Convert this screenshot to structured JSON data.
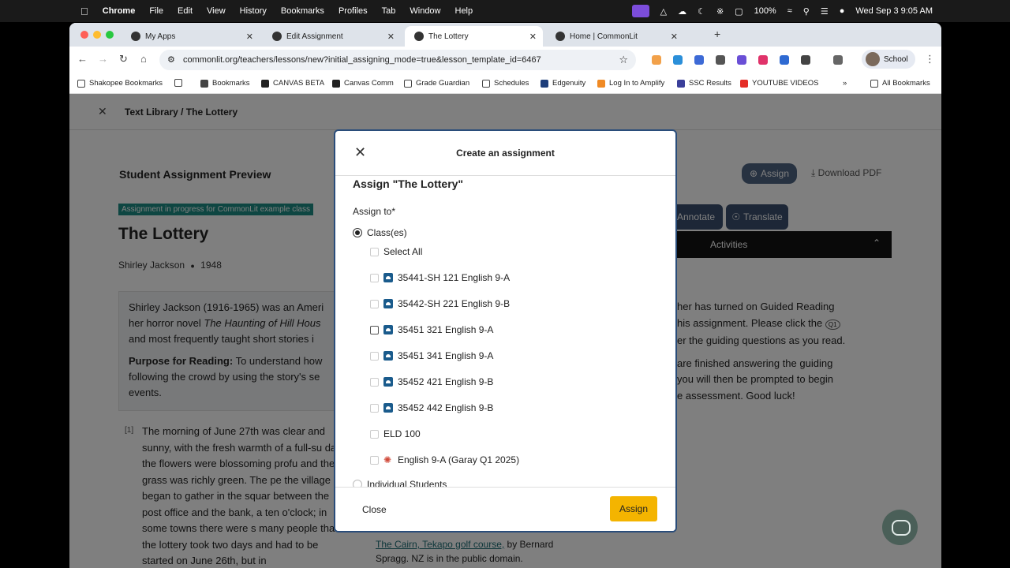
{
  "menubar": {
    "app": "Chrome",
    "items": [
      "File",
      "Edit",
      "View",
      "History",
      "Bookmarks",
      "Profiles",
      "Tab",
      "Window",
      "Help"
    ],
    "battery": "100%",
    "datetime": "Wed Sep 3  9:05 AM"
  },
  "tabs": [
    {
      "label": "My Apps"
    },
    {
      "label": "Edit Assignment"
    },
    {
      "label": "The Lottery"
    },
    {
      "label": "Home | CommonLit"
    }
  ],
  "toolbar": {
    "url": "commonlit.org/teachers/lessons/new?initial_assigning_mode=true&lesson_template_id=6467",
    "profile": "School"
  },
  "bookmarks": [
    "Shakopee Bookmarks",
    "Bookmarks",
    "CANVAS BETA",
    "Canvas Comm",
    "Grade Guardian",
    "Schedules",
    "Edgenuity",
    "Log In to Amplify",
    "SSC Results",
    "YOUTUBE VIDEOS",
    "All Bookmarks"
  ],
  "page": {
    "breadcrumb": "Text Library / The Lottery",
    "preview_title": "Student Assignment Preview",
    "badge": "Assignment in progress for CommonLit example class",
    "book_title": "The Lottery",
    "author": "Shirley Jackson",
    "year": "1948",
    "intro_line1": "Shirley Jackson (1916-1965) was an Ameri",
    "intro_line2a": "her horror novel ",
    "intro_line2b": "The Haunting of Hill Hous",
    "intro_line3": "and most frequently taught short stories i",
    "purpose_label": "Purpose for Reading:",
    "purpose_text": " To understand how",
    "purpose_line2": "following the crowd by using the story's se",
    "purpose_line3": "events.",
    "para_num": "[1]",
    "para_text": "The morning of June 27th was clear and sunny, with the fresh warmth of a full-su day; the flowers were blossoming profu and the grass was richly green. The pe the village began to gather in the squar between the post office and the bank, a ten o'clock; in some towns there were s many people that the lottery took two days and had to be started on June 26th, but in",
    "caption_link": "The Cairn, Tekapo golf course,",
    "caption_text": " by Bernard Spragg. NZ is in the public domain.",
    "assign_btn": "Assign",
    "download": "Download PDF",
    "annotate": "Annotate",
    "translate": "Translate",
    "activities": "Activities",
    "guided_p1a": "her has turned on Guided Reading",
    "guided_p1b": "his assignment. Please click the",
    "guided_p1c": "er the guiding questions as you read.",
    "guided_p2a": "are finished answering the guiding",
    "guided_p2b": "you will then be prompted to begin",
    "guided_p2c": "e assessment. Good luck!"
  },
  "modal": {
    "title": "Create an assignment",
    "assign_heading": "Assign \"The Lottery\"",
    "assign_to": "Assign to*",
    "option_classes": "Class(es)",
    "select_all": "Select All",
    "classes": [
      "35441-SH 121 English 9-A",
      "35442-SH 221 English 9-B",
      "35451 321 English 9-A",
      "35451 341 English 9-A",
      "35452 421 English 9-B",
      "35452 442 English 9-B",
      "ELD 100",
      "English 9-A (Garay Q1 2025)"
    ],
    "option_individual": "Individual Students",
    "close": "Close",
    "assign": "Assign"
  },
  "colors": {
    "accent_yellow": "#f4b400",
    "teal": "#1c8d84",
    "slate_button": "#3a4f6e"
  }
}
